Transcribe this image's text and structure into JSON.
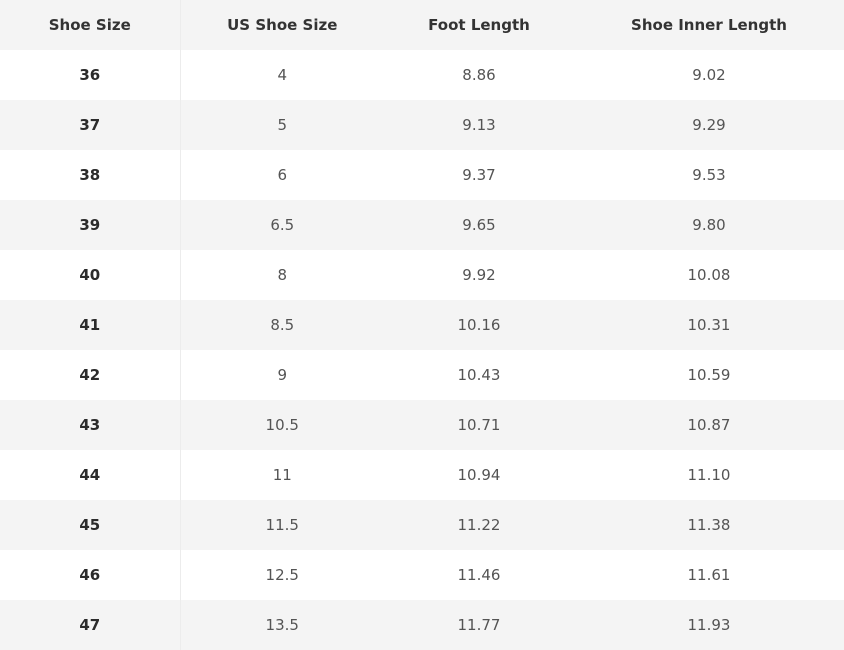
{
  "table": {
    "headers": [
      "Shoe Size",
      "US Shoe Size",
      "Foot Length",
      "Shoe Inner Length"
    ],
    "rows": [
      [
        "36",
        "4",
        "8.86",
        "9.02"
      ],
      [
        "37",
        "5",
        "9.13",
        "9.29"
      ],
      [
        "38",
        "6",
        "9.37",
        "9.53"
      ],
      [
        "39",
        "6.5",
        "9.65",
        "9.80"
      ],
      [
        "40",
        "8",
        "9.92",
        "10.08"
      ],
      [
        "41",
        "8.5",
        "10.16",
        "10.31"
      ],
      [
        "42",
        "9",
        "10.43",
        "10.59"
      ],
      [
        "43",
        "10.5",
        "10.71",
        "10.87"
      ],
      [
        "44",
        "11",
        "10.94",
        "11.10"
      ],
      [
        "45",
        "11.5",
        "11.22",
        "11.38"
      ],
      [
        "46",
        "12.5",
        "11.46",
        "11.61"
      ],
      [
        "47",
        "13.5",
        "11.77",
        "11.93"
      ]
    ]
  },
  "colors": {
    "stripe": "#f4f4f4",
    "background": "#ffffff",
    "text": "#545454",
    "header_text": "#333333"
  }
}
